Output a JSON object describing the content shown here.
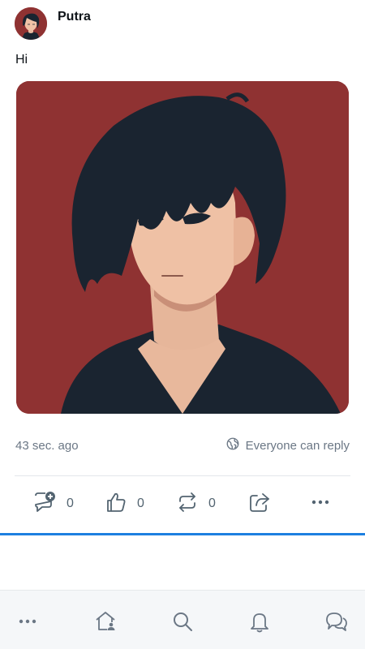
{
  "post": {
    "author": "Putra",
    "text": "Hi",
    "timestamp": "43 sec. ago",
    "reply_setting": "Everyone can reply",
    "image_background": "#8f3232"
  },
  "actions": [
    {
      "name": "reply",
      "icon": "comment-plus-icon",
      "count": "0"
    },
    {
      "name": "like",
      "icon": "thumbs-up-icon",
      "count": "0"
    },
    {
      "name": "repost",
      "icon": "repost-icon",
      "count": "0"
    },
    {
      "name": "share",
      "icon": "share-icon"
    },
    {
      "name": "more",
      "icon": "more-horizontal-icon"
    }
  ],
  "bottom_nav": [
    "more-icon",
    "home-icon",
    "search-icon",
    "bell-icon",
    "chat-icon"
  ],
  "colors": {
    "accent": "#1d7fe0",
    "muted_text": "#6b7785",
    "nav_background": "#f5f7f9"
  }
}
